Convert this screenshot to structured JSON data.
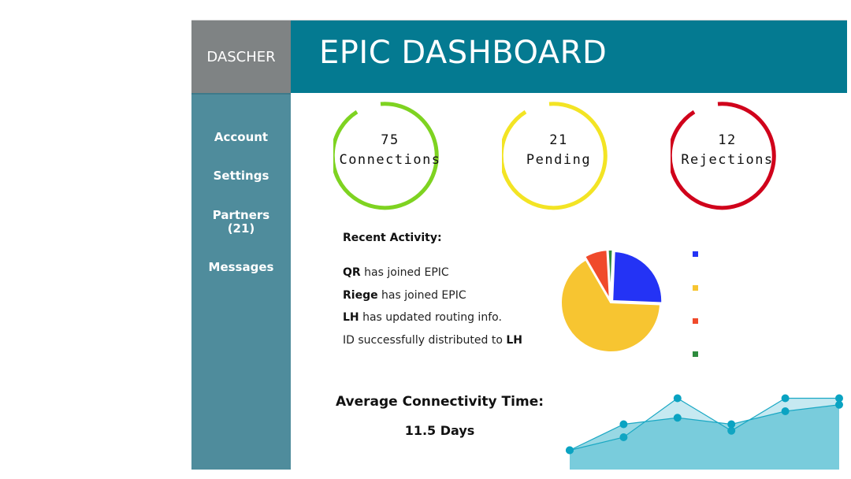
{
  "brand": "DASCHER",
  "title": "EPIC DASHBOARD",
  "nav": [
    {
      "label": "Account"
    },
    {
      "label": "Settings"
    },
    {
      "label_line1": "Partners",
      "label_line2": "(21)"
    },
    {
      "label": "Messages"
    }
  ],
  "stats": [
    {
      "value": "75",
      "label": "Connections",
      "color": "#7ed321"
    },
    {
      "value": "21",
      "label": "Pending",
      "color": "#f3e424"
    },
    {
      "value": "12",
      "label": "Rejections",
      "color": "#d0021b"
    }
  ],
  "recent_activity": {
    "heading": "Recent Activity:",
    "items": [
      {
        "bold": "QR",
        "text": " has joined EPIC"
      },
      {
        "bold": "Riege",
        "text": " has joined EPIC"
      },
      {
        "bold": "LH",
        "text": " has updated  routing info."
      },
      {
        "text": "ID successfully distributed to ",
        "bold_end": "LH"
      }
    ]
  },
  "chart_data": [
    {
      "type": "pie",
      "slices": [
        {
          "value": 25,
          "color": "#2433f5"
        },
        {
          "value": 66,
          "color": "#f7c531"
        },
        {
          "value": 7.5,
          "color": "#f04a2b"
        },
        {
          "value": 1.5,
          "color": "#2e8b3e"
        }
      ],
      "legend_colors": [
        "#2433f5",
        "#f7c531",
        "#f04a2b",
        "#2e8b3e"
      ]
    },
    {
      "type": "area",
      "series": [
        {
          "values": [
            1,
            2,
            5,
            2.5,
            5,
            5
          ],
          "color": "#5dbfd6"
        },
        {
          "values": [
            1,
            3,
            3.5,
            3,
            4,
            4.5
          ],
          "color": "#1aa8c4"
        }
      ],
      "ylim": [
        0,
        6
      ]
    }
  ],
  "metric": {
    "label": "Average Connectivity Time:",
    "value": "11.5 Days"
  }
}
